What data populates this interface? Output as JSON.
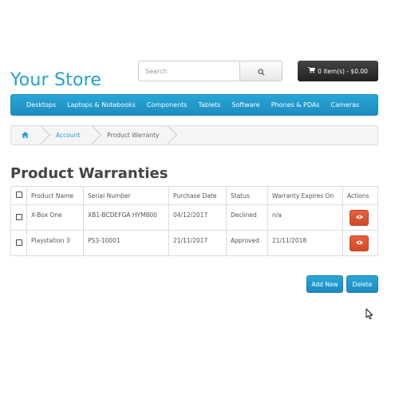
{
  "header": {
    "logo": "Your Store",
    "search_placeholder": "Search",
    "cart_label": "0 item(s) - $0.00"
  },
  "menu": {
    "items": [
      "Desktops",
      "Laptops & Notebooks",
      "Components",
      "Tablets",
      "Software",
      "Phones & PDAs",
      "Cameras"
    ]
  },
  "breadcrumb": {
    "account": "Account",
    "current": "Product Warranty"
  },
  "page": {
    "title": "Product Warranties"
  },
  "table": {
    "headers": [
      "Product Name",
      "Serial Number",
      "Purchase Date",
      "Status",
      "Warranty Expires On",
      "Actions"
    ],
    "rows": [
      {
        "product": "X-Box One",
        "serial": "XB1-BCDEFGA HYM800",
        "purchase_date": "04/12/2017",
        "status": "Declined",
        "expires": "n/a"
      },
      {
        "product": "Playstation 3",
        "serial": "PS3-10001",
        "purchase_date": "21/11/2017",
        "status": "Approved",
        "expires": "21/11/2018"
      }
    ]
  },
  "buttons": {
    "add_new": "Add New",
    "delete": "Delete"
  },
  "colors": {
    "brand": "#23a1d1",
    "menu_bg": "#229ac8",
    "action_button": "#e0572e",
    "cart_bg": "#363636"
  },
  "icons": {
    "search": "search-icon",
    "cart": "cart-icon",
    "home": "home-icon",
    "view": "eye-icon",
    "cursor": "mouse-cursor"
  }
}
